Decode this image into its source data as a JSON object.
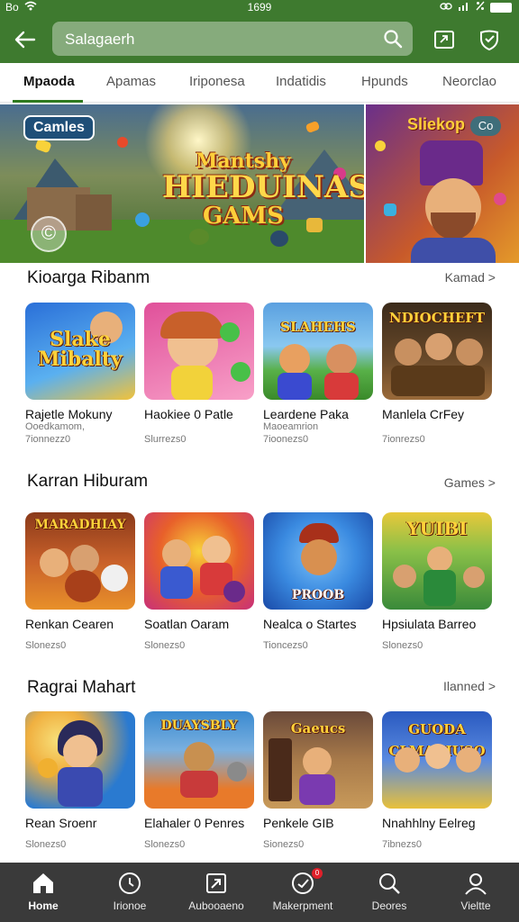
{
  "status_bar": {
    "carrier": "Bo",
    "time": "1699"
  },
  "header": {
    "search_text": "Salagaerh"
  },
  "tabs": [
    {
      "label": "Mpaoda",
      "active": true
    },
    {
      "label": "Apamas",
      "active": false
    },
    {
      "label": "Iriponesa",
      "active": false
    },
    {
      "label": "Indatidis",
      "active": false
    },
    {
      "label": "Hpunds",
      "active": false
    },
    {
      "label": "Neorclao",
      "active": false
    }
  ],
  "banner": {
    "tag": "Camles",
    "title_line1": "Mantshy",
    "title_line2": "HIEDUINAS",
    "title_line3": "GAMS",
    "circle_glyph": "©",
    "side_title": "Sliekop",
    "side_pill": "Co"
  },
  "sections": [
    {
      "title": "Kioarga Ribanm",
      "more": "Kamad >",
      "cards": [
        {
          "thumb_label": "Slake Mibalty",
          "name": "Rajetle Mokuny",
          "sub1": "Ooedkamom,",
          "sub2": "7ionnezz0",
          "colors": [
            "#2a6fd8",
            "#f2c23a"
          ]
        },
        {
          "thumb_label": "",
          "name": "Haokiee 0 Patle",
          "sub1": "",
          "sub2": "Slurrezs0",
          "colors": [
            "#e0509a",
            "#f8a0c8"
          ]
        },
        {
          "thumb_label": "SLAHEHS",
          "name": "Leardene Paka",
          "sub1": "Maoeamrion",
          "sub2": "7ioonezs0",
          "colors": [
            "#5aa0e0",
            "#58b048"
          ]
        },
        {
          "thumb_label": "NDIOCHEFT",
          "name": "Manlela CrFey",
          "sub1": "",
          "sub2": "7ionrezs0",
          "colors": [
            "#3a2a1a",
            "#9a6a3a"
          ]
        }
      ]
    },
    {
      "title": "Karran Hiburam",
      "more": "Games >",
      "cards": [
        {
          "thumb_label": "MARADHIAY",
          "name": "Renkan Cearen",
          "sub1": "",
          "sub2": "Slonezs0",
          "colors": [
            "#8a3a1a",
            "#e8902a"
          ]
        },
        {
          "thumb_label": "",
          "name": "Soatlan Oaram",
          "sub1": "",
          "sub2": "Slonezs0",
          "colors": [
            "#c8307a",
            "#f8c23a"
          ]
        },
        {
          "thumb_label": "PROOB",
          "name": "Nealca o Startes",
          "sub1": "",
          "sub2": "Tioncezs0",
          "colors": [
            "#1a4aa8",
            "#3a8ae0"
          ]
        },
        {
          "thumb_label": "YUIBI",
          "name": "Hpsiulata Barreo",
          "sub1": "",
          "sub2": "Slonezs0",
          "colors": [
            "#3a8a3a",
            "#e8c83a"
          ]
        }
      ]
    },
    {
      "title": "Ragrai Mahart",
      "more": "Ilanned >",
      "cards": [
        {
          "thumb_label": "",
          "name": "Rean Sroenr",
          "sub1": "",
          "sub2": "Slonezs0",
          "colors": [
            "#2a7ad0",
            "#f0b040"
          ]
        },
        {
          "thumb_label": "DUAYSBLY",
          "name": "Elahaler 0 Penres",
          "sub1": "",
          "sub2": "Slonezs0",
          "colors": [
            "#3a8ad0",
            "#e87a2a"
          ]
        },
        {
          "thumb_label": "Gaeucs",
          "name": "Penkele GIB",
          "sub1": "",
          "sub2": "Sionezs0",
          "colors": [
            "#6a4a3a",
            "#c89a5a"
          ]
        },
        {
          "thumb_label": "GUODA CLMARIUSO",
          "name": "Nnahhlny Eelreg",
          "sub1": "",
          "sub2": "7ibnezs0",
          "colors": [
            "#2a5ac0",
            "#e8c03a"
          ]
        }
      ]
    }
  ],
  "bottom_nav": [
    {
      "label": "Home",
      "icon": "home-icon",
      "active": true
    },
    {
      "label": "Irionoe",
      "icon": "clock-icon",
      "active": false
    },
    {
      "label": "Aubooaeno",
      "icon": "arrow-box-icon",
      "active": false
    },
    {
      "label": "Makerpment",
      "icon": "chat-icon",
      "active": false,
      "badge": "0"
    },
    {
      "label": "Deores",
      "icon": "search-icon",
      "active": false
    },
    {
      "label": "Vieltte",
      "icon": "profile-icon",
      "active": false
    }
  ],
  "colors": {
    "header_green": "#3e7a2f",
    "tab_accent": "#2f7a1f",
    "nav_bg": "#3a3a3a"
  }
}
